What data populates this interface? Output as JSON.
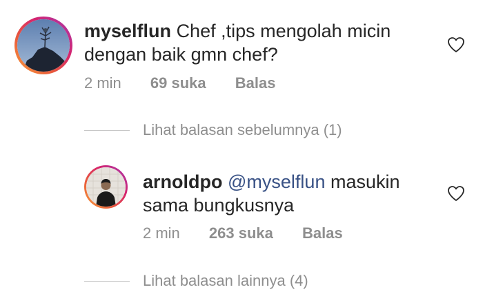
{
  "comments": [
    {
      "username": "myselflun",
      "mention": "",
      "text_line1": "Chef ,tips mengolah micin",
      "text_line2": "dengan baik gmn chef?",
      "time": "2 min",
      "likes": "69 suka",
      "reply": "Balas",
      "avatar_icon": "profile-photo-icon",
      "like_icon": "heart-outline-icon"
    },
    {
      "username": "arnoldpo",
      "mention": "@myselflun",
      "text_line1": "masukin",
      "text_line2": "sama bungkusnya",
      "time": "2 min",
      "likes": "263 suka",
      "reply": "Balas",
      "avatar_icon": "profile-photo-icon",
      "like_icon": "heart-outline-icon"
    }
  ],
  "threads": {
    "view_previous": "Lihat balasan sebelumnya (1)",
    "view_more": "Lihat balasan lainnya (4)"
  },
  "colors": {
    "text": "#262626",
    "muted": "#8e8e8e",
    "mention": "#385185",
    "ring_start": "#f9a13b",
    "ring_end": "#a23bb3"
  }
}
